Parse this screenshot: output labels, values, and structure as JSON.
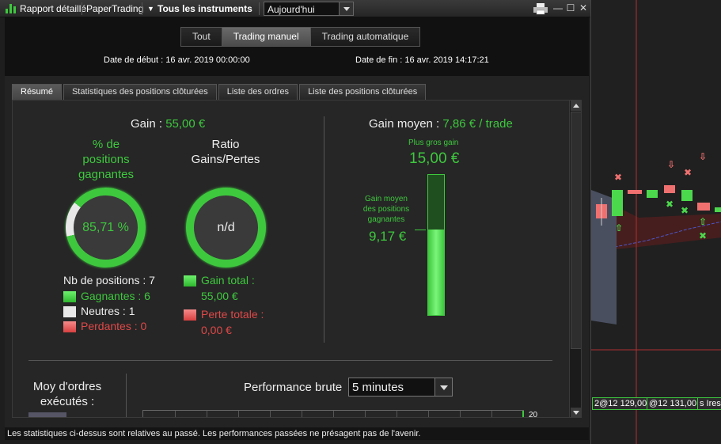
{
  "toolbar": {
    "report_label": "Rapport détaillé",
    "account_label": "PaperTrading",
    "instruments_label": "Tous les instruments",
    "period_value": "Aujourd'hui",
    "minimize": "—",
    "maximize": "☐",
    "close": "✕"
  },
  "mode_tabs": [
    {
      "label": "Tout",
      "active": false
    },
    {
      "label": "Trading manuel",
      "active": true
    },
    {
      "label": "Trading automatique",
      "active": false
    }
  ],
  "dates": {
    "start": "Date de début : 16 avr. 2019 00:00:00",
    "end": "Date de fin : 16 avr. 2019 14:17:21"
  },
  "sub_tabs": [
    {
      "label": "Résumé",
      "active": true
    },
    {
      "label": "Statistiques des positions clôturées",
      "active": false
    },
    {
      "label": "Liste des ordres",
      "active": false
    },
    {
      "label": "Liste des positions clôturées",
      "active": false
    }
  ],
  "summary": {
    "gain_label": "Gain : ",
    "gain_value": "55,00 €",
    "win_pct_title_1": "% de",
    "win_pct_title_2": "positions",
    "win_pct_title_3": "gagnantes",
    "win_pct_value": "85,71 %",
    "win_fraction": 0.8571,
    "ratio_title_1": "Ratio",
    "ratio_title_2": "Gains/Pertes",
    "ratio_value": "n/d",
    "nb_positions": "Nb de positions : 7",
    "winners": "Gagnantes : 6",
    "neutral": "Neutres : 1",
    "losers": "Perdantes : 0",
    "total_gain_label": "Gain total :",
    "total_gain_value": "55,00 €",
    "total_loss_label": "Perte totale :",
    "total_loss_value": "0,00 €",
    "avg_gain_label": "Gain moyen : ",
    "avg_gain_value": "7,86 € / trade",
    "max_gain_label": "Plus gros gain",
    "max_gain_value": "15,00 €",
    "avg_win_label_1": "Gain moyen",
    "avg_win_label_2": "des positions",
    "avg_win_label_3": "gagnantes",
    "avg_win_value": "9,17 €",
    "avg_win_fraction": 0.611,
    "orders_label_1": "Moy d'ordres",
    "orders_label_2": "exécutés :",
    "perf_label": "Performance brute",
    "perf_interval": "5 minutes",
    "perf_axis_tick": "20"
  },
  "status_text": "Les statistiques ci-dessus sont relatives au passé. Les performances passées ne présagent pas de l'avenir.",
  "chart_side": {
    "label_1": "2@12 129,00",
    "label_2": "@12 131,00",
    "label_3": "s Ires"
  },
  "colors": {
    "gain_green": "#3ec83e",
    "loss_red": "#e04848",
    "neutral_white": "#e8e8e8"
  }
}
